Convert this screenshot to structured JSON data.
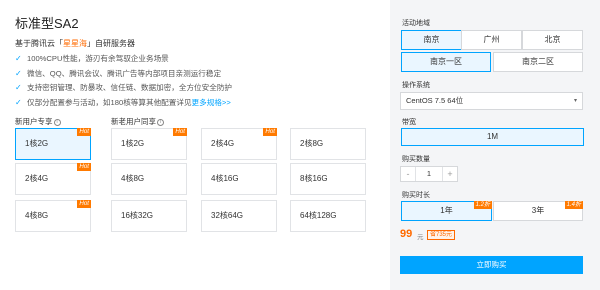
{
  "product": {
    "title": "标准型SA2",
    "subtitle_prefix": "基于腾讯云「",
    "subtitle_highlight": "星星海",
    "subtitle_suffix": "」自研服务器"
  },
  "features": [
    "100%CPU性能，游刃有余驾驭企业务场景",
    "微信、QQ、腾讯会议、腾讯广告等内部项目亲测运行稳定",
    "支持密钥管理、防暴攻、信任链、数据加密，全方位安全防护",
    "仅部分配置参与活动，如180核等算其他配置详见"
  ],
  "more_link": "更多规格>>",
  "groups": {
    "new_user": {
      "label": "新用户专享",
      "info": "i"
    },
    "all_user": {
      "label": "新老用户同享",
      "info": "i"
    }
  },
  "hot_badge": "Hot",
  "new_user_cards": [
    {
      "label": "1核2G"
    },
    {
      "label": "2核4G"
    },
    {
      "label": "4核8G"
    }
  ],
  "all_user_cards": [
    {
      "label": "1核2G"
    },
    {
      "label": "2核4G"
    },
    {
      "label": "2核8G"
    },
    {
      "label": "4核8G"
    },
    {
      "label": "4核16G"
    },
    {
      "label": "8核16G"
    },
    {
      "label": "16核32G"
    },
    {
      "label": "32核64G"
    },
    {
      "label": "64核128G"
    }
  ],
  "region": {
    "label": "活动地域",
    "cities": [
      "南京",
      "广州",
      "北京"
    ],
    "zones": [
      "南京一区",
      "南京二区"
    ]
  },
  "os": {
    "label": "操作系统",
    "value": "CentOS 7.5 64位"
  },
  "bandwidth": {
    "label": "带宽",
    "value": "1M"
  },
  "quantity": {
    "label": "购买数量",
    "minus": "-",
    "value": "1",
    "plus": "+"
  },
  "duration": {
    "label": "购买时长",
    "options": [
      {
        "label": "1年",
        "discount": "1.2折"
      },
      {
        "label": "3年",
        "discount": "1.4折"
      }
    ]
  },
  "price": {
    "value": "99",
    "unit": "元",
    "save": "省735元"
  },
  "buy_button": "立即购买",
  "colors": {
    "accent": "#00a4ff",
    "hot": "#ff7a00",
    "price": "#ff6a00"
  }
}
